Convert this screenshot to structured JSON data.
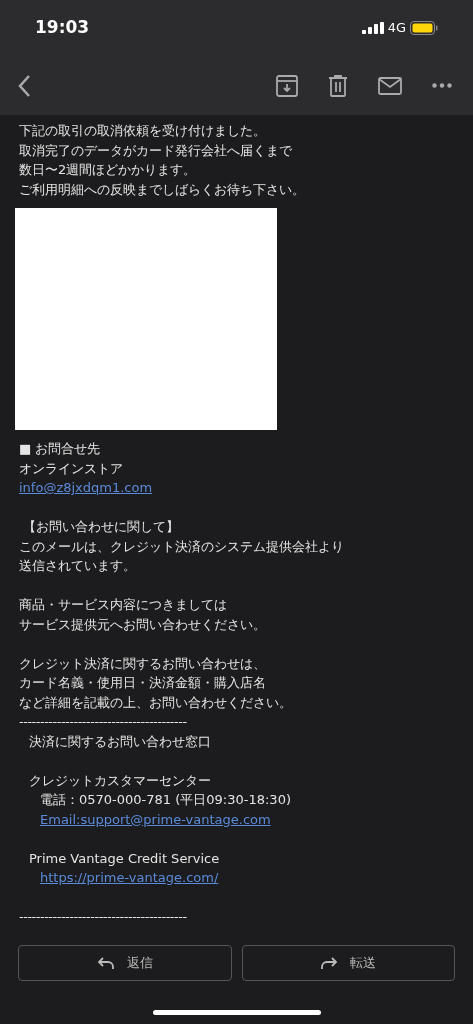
{
  "status_bar": {
    "time": "19:03",
    "network": "4G"
  },
  "body": [
    {
      "kind": "text",
      "text": "下記の取引の取消依頼を受け付けました。"
    },
    {
      "kind": "text",
      "text": "取消完了のデータがカード発行会社へ届くまで"
    },
    {
      "kind": "text",
      "text": "数日〜2週間ほどかかります。"
    },
    {
      "kind": "text",
      "text": "ご利用明細への反映までしばらくお待ち下さい。"
    },
    {
      "kind": "image"
    },
    {
      "kind": "text",
      "text": "■ お問合せ先"
    },
    {
      "kind": "text",
      "text": "オンラインストア"
    },
    {
      "kind": "link",
      "text": "info@z8jxdqm1.com"
    },
    {
      "kind": "gap"
    },
    {
      "kind": "text",
      "text": " 【お問い合わせに関して】"
    },
    {
      "kind": "text",
      "text": "このメールは、クレジット決済のシステム提供会社より"
    },
    {
      "kind": "text",
      "text": "送信されています。"
    },
    {
      "kind": "gap"
    },
    {
      "kind": "text",
      "text": "商品・サービス内容につきましては"
    },
    {
      "kind": "text",
      "text": "サービス提供元へお問い合わせください。"
    },
    {
      "kind": "gap"
    },
    {
      "kind": "text",
      "text": "クレジット決済に関するお問い合わせは、"
    },
    {
      "kind": "text",
      "text": "カード名義・使用日・決済金額・購入店名"
    },
    {
      "kind": "text",
      "text": "など詳細を記載の上、お問い合わせください。"
    },
    {
      "kind": "rule",
      "text": "----------------------------------------"
    },
    {
      "kind": "indented",
      "text": "決済に関するお問い合わせ窓口"
    },
    {
      "kind": "gap"
    },
    {
      "kind": "indented",
      "text": "クレジットカスタマーセンター"
    },
    {
      "kind": "deep",
      "text": "電話：0570-000-781 (平日09:30-18:30)"
    },
    {
      "kind": "deep_link",
      "text": "Email:support@prime-vantage.com"
    },
    {
      "kind": "gap"
    },
    {
      "kind": "indented",
      "text": "Prime Vantage Credit Service"
    },
    {
      "kind": "deep_link",
      "text": "https://prime-vantage.com/"
    },
    {
      "kind": "gap"
    },
    {
      "kind": "rule",
      "text": "----------------------------------------"
    }
  ],
  "actions": [
    {
      "kind": "reply",
      "label": "返信"
    },
    {
      "kind": "forward",
      "label": "転送"
    }
  ]
}
